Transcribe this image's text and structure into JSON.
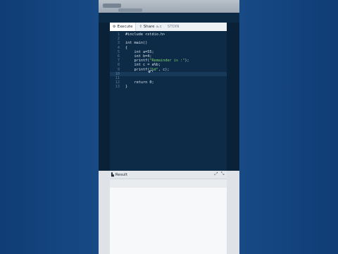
{
  "toolbar": {
    "execute_label": "Execute",
    "share_label": "Share",
    "share_extra": "a.c",
    "stdin_label": "STDIN"
  },
  "editor": {
    "lines": [
      {
        "num": "1",
        "text": "#include <stdio.h>",
        "kind": "inc"
      },
      {
        "num": "2",
        "text": "",
        "kind": "plain"
      },
      {
        "num": "3",
        "text": "int main()",
        "kind": "plain"
      },
      {
        "num": "4",
        "text": "{",
        "kind": "plain"
      },
      {
        "num": "5",
        "text": "    int a=55;",
        "kind": "plain"
      },
      {
        "num": "6",
        "text": "    int b=4;",
        "kind": "plain"
      },
      {
        "num": "7",
        "pre": "    printf(",
        "str": "\"Remainder is :\"",
        "post": ");",
        "kind": "str"
      },
      {
        "num": "8",
        "text": "    int c = a%b;",
        "kind": "plain"
      },
      {
        "num": "9",
        "pre": "    printf(",
        "str": "\"%d\"",
        "post": ", c);",
        "kind": "str"
      },
      {
        "num": "10",
        "text": "",
        "kind": "plain",
        "current": true
      },
      {
        "num": "11",
        "text": "",
        "kind": "plain"
      },
      {
        "num": "12",
        "text": "    return 0;",
        "kind": "plain"
      },
      {
        "num": "13",
        "text": "}",
        "kind": "plain"
      }
    ]
  },
  "result": {
    "title": "Result",
    "icons": {
      "expand": "expand-icon",
      "collapse": "collapse-icon"
    }
  }
}
